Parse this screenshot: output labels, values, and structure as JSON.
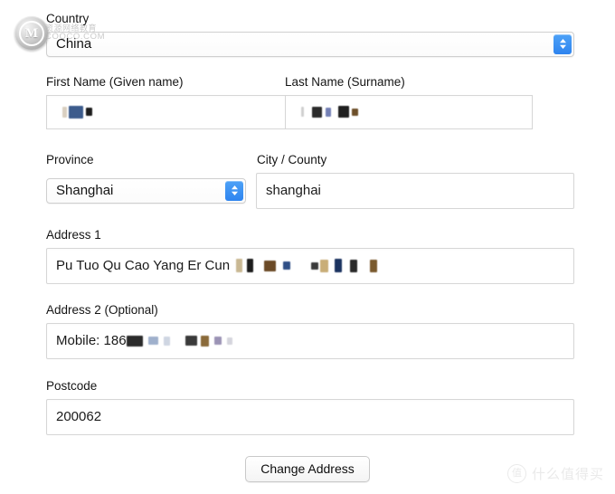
{
  "watermarks": {
    "logo_letter": "M",
    "logo_name": "cooco-logo-icon",
    "cn_text": "资源网络教育",
    "en_text": "COOCO.COM",
    "smzdm_badge": "值",
    "smzdm_text": "什么值得买"
  },
  "form": {
    "country": {
      "label": "Country",
      "value": "China",
      "options": [
        "China"
      ]
    },
    "first_name": {
      "label": "First Name (Given name)",
      "value": "",
      "redacted": true
    },
    "last_name": {
      "label": "Last Name (Surname)",
      "value": "",
      "redacted": true
    },
    "province": {
      "label": "Province",
      "value": "Shanghai",
      "options": [
        "Shanghai"
      ]
    },
    "city": {
      "label": "City / County",
      "value": "shanghai"
    },
    "address1": {
      "label": "Address 1",
      "value": "Pu Tuo Qu Cao Yang Er Cun",
      "redacted_suffix": true
    },
    "address2": {
      "label": "Address 2 (Optional)",
      "value": "Mobile: 186",
      "redacted_suffix": true
    },
    "postcode": {
      "label": "Postcode",
      "value": "200062"
    },
    "submit": {
      "label": "Change Address"
    }
  },
  "colors": {
    "accent_blue": "#2e84ef",
    "field_border": "#d6d6d6",
    "text": "#1a1a1a",
    "watermark_grey": "#b9b9b9",
    "smzdm_grey": "#eaeaea"
  }
}
